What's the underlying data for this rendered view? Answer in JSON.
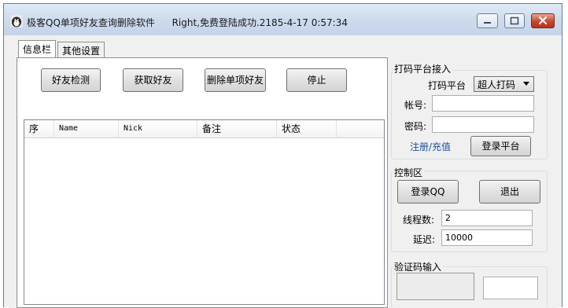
{
  "window": {
    "title": "极客QQ单项好友查询删除软件",
    "status": "Right,免费登陆成功.2185-4-17 0:57:34"
  },
  "tabs": [
    {
      "label": "信息栏",
      "active": true
    },
    {
      "label": "其他设置",
      "active": false
    }
  ],
  "toolbar": {
    "check_friends": "好友检测",
    "get_friends": "获取好友",
    "delete_single": "删除单项好友",
    "stop": "停止"
  },
  "friend_list": {
    "columns": [
      "序",
      "Name",
      "Nick",
      "备注",
      "状态"
    ],
    "rows": []
  },
  "captcha_platform": {
    "title": "打码平台接入",
    "platform_label": "打码平台",
    "platform_value": "超人打码",
    "account_label": "帐号:",
    "account_value": "",
    "password_label": "密码:",
    "password_value": "",
    "register_link": "注册/充值",
    "login_button": "登录平台"
  },
  "control": {
    "title": "控制区",
    "login_qq": "登录QQ",
    "exit": "退出",
    "threads_label": "线程数:",
    "threads_value": "2",
    "delay_label": "延迟:",
    "delay_value": "10000"
  },
  "captcha_input": {
    "title": "验证码输入",
    "value": ""
  },
  "colors": {
    "title_bar": "#c4d4e9",
    "close_button": "#c8462e",
    "link": "#1e4fa0"
  }
}
